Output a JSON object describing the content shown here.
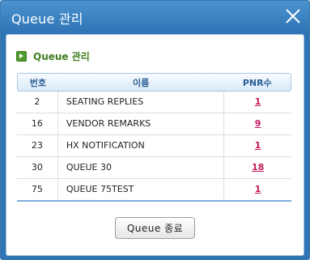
{
  "window": {
    "title": "Queue 관리"
  },
  "section": {
    "title": "Queue 관리"
  },
  "table": {
    "headers": {
      "no": "번호",
      "name": "이름",
      "pnr": "PNR수"
    },
    "rows": [
      {
        "no": "2",
        "name": "SEATING REPLIES",
        "pnr": "1"
      },
      {
        "no": "16",
        "name": "VENDOR REMARKS",
        "pnr": "9"
      },
      {
        "no": "23",
        "name": "HX NOTIFICATION",
        "pnr": "1"
      },
      {
        "no": "30",
        "name": "QUEUE 30",
        "pnr": "18"
      },
      {
        "no": "75",
        "name": "QUEUE 75TEST",
        "pnr": "1"
      }
    ]
  },
  "footer": {
    "close_label": "Queue 종료"
  },
  "icons": {
    "close": "close-icon",
    "bullet": "arrow-bullet-icon"
  },
  "colors": {
    "titlebar": "#2f74b5",
    "link": "#c2185b",
    "section": "#3f7d1d"
  }
}
